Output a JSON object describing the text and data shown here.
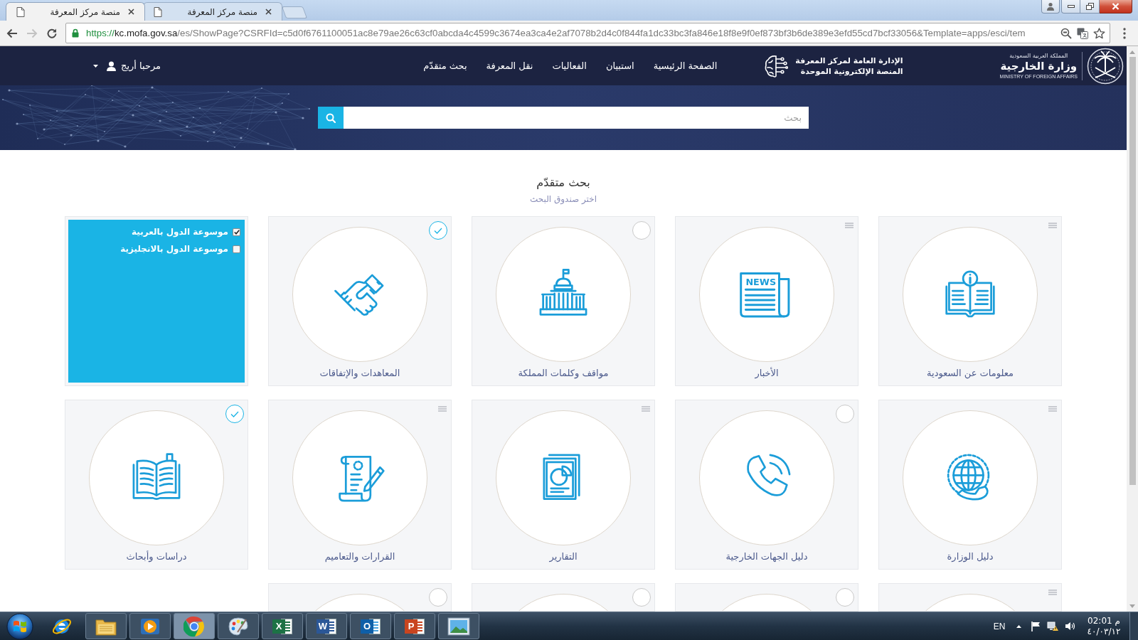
{
  "browser": {
    "tabs": [
      {
        "title": "منصة مركز المعرفة",
        "selected": false
      },
      {
        "title": "منصة مركز المعرفة",
        "selected": true
      }
    ],
    "address": {
      "scheme": "https://",
      "host": "kc.mofa.gov.sa",
      "path": "/es/ShowPage?CSRFId=c5d0f6761100051ac8e79ae26c63cf0abcda4c4599c3674ea3ca4e2af7078b2d4c0f844fa1dc33bc3fa846e18f8e9f0ef873bf3b6de389e3efd55cd7bcf33056&Template=apps/esci/tem"
    }
  },
  "header": {
    "ministry_logo": {
      "country": "المملكة العربية السعودية",
      "name": "وزارة الخارجية",
      "name_english": "MINISTRY OF FOREIGN AFFAIRS"
    },
    "platform_logo": {
      "line_1": "الإدارة العامة لمركز المعرفة",
      "line_2": "المنصة الإلكترونية الموحدة"
    },
    "nav": [
      {
        "label": "الصفحة الرئيسية"
      },
      {
        "label": "استبيان"
      },
      {
        "label": "الفعاليات"
      },
      {
        "label": "نقل المعرفة"
      },
      {
        "label": "بحث متقدّم"
      }
    ],
    "user": {
      "greeting": "مرحبا أريج"
    }
  },
  "search": {
    "placeholder": "بحث"
  },
  "advanced_search": {
    "title": "بحث متقدّم",
    "subtitle": "اختر صندوق البحث"
  },
  "tiles": [
    {
      "kind": "card",
      "title": "معلومات عن السعودية",
      "marker": {
        "kind": "menu"
      }
    },
    {
      "kind": "card",
      "title": "الأخبار",
      "marker": {
        "kind": "menu"
      },
      "icon_text": "NEWS"
    },
    {
      "kind": "card",
      "title": "مواقف وكلمات المملكة",
      "marker": {
        "kind": "toggle",
        "selected": false
      }
    },
    {
      "kind": "card",
      "title": "المعاهدات والإتفاقات",
      "marker": {
        "kind": "toggle",
        "selected": true
      }
    },
    {
      "kind": "options",
      "options": [
        {
          "label": "موسوعة الدول بالعربية",
          "checked": true
        },
        {
          "label": "موسوعة الدول بالانجليزية",
          "checked": false
        }
      ]
    },
    {
      "kind": "card",
      "title": "دليل الوزارة",
      "marker": {
        "kind": "menu"
      }
    },
    {
      "kind": "card",
      "title": "دليل الجهات الخارجية",
      "marker": {
        "kind": "toggle",
        "selected": false
      }
    },
    {
      "kind": "card",
      "title": "التقارير",
      "marker": {
        "kind": "menu"
      }
    },
    {
      "kind": "card",
      "title": "القرارات والتعاميم",
      "marker": {
        "kind": "menu"
      }
    },
    {
      "kind": "card",
      "title": "دراسات وأبحاث",
      "marker": {
        "kind": "toggle",
        "selected": true
      }
    },
    {
      "kind": "card",
      "marker": {
        "kind": "menu"
      }
    },
    {
      "kind": "card",
      "marker": {
        "kind": "toggle",
        "selected": false
      }
    },
    {
      "kind": "card",
      "marker": {
        "kind": "toggle",
        "selected": false
      }
    },
    {
      "kind": "card",
      "marker": {
        "kind": "toggle",
        "selected": false
      }
    }
  ],
  "taskbar": {
    "apps": [
      {
        "running": true,
        "selected": false
      },
      {
        "running": true,
        "selected": false,
        "letter": "P"
      },
      {
        "running": true,
        "selected": false,
        "letter": "O"
      },
      {
        "running": true,
        "selected": false,
        "letter": "W"
      },
      {
        "running": true,
        "selected": false,
        "letter": "X"
      },
      {
        "running": true,
        "selected": false
      },
      {
        "running": true,
        "selected": true
      },
      {
        "running": true,
        "selected": false
      },
      {
        "running": true,
        "selected": false
      },
      {
        "running": false,
        "selected": false
      }
    ],
    "language": "EN",
    "time": "02:01 م",
    "date": "٤٠/٠٣/١٢"
  }
}
